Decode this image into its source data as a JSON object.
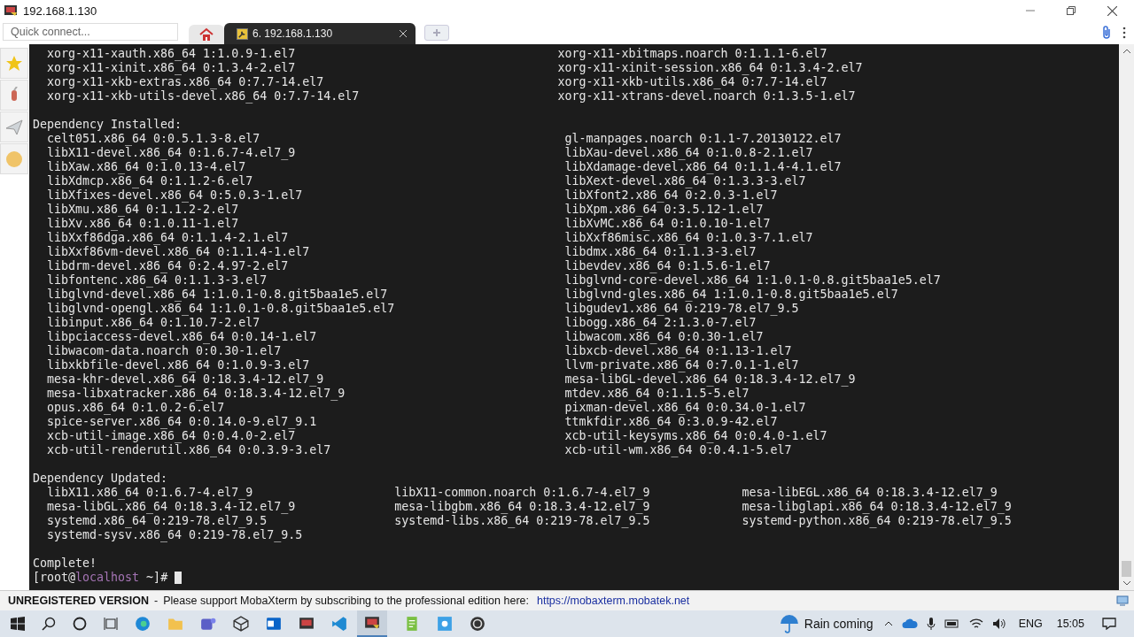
{
  "window": {
    "title": "192.168.1.130"
  },
  "tab_bar": {
    "quick_connect": {
      "placeholder": "Quick connect..."
    },
    "tabs": [
      {
        "label": "6. 192.168.1.130",
        "selected": true
      }
    ]
  },
  "terminal": {
    "blocks": [
      {
        "rows": [
          [
            "xorg-x11-xauth.x86_64 1:1.0.9-1.el7",
            "xorg-x11-xbitmaps.noarch 0:1.1.1-6.el7"
          ],
          [
            "xorg-x11-xinit.x86_64 0:1.3.4-2.el7",
            "xorg-x11-xinit-session.x86_64 0:1.3.4-2.el7"
          ],
          [
            "xorg-x11-xkb-extras.x86_64 0:7.7-14.el7",
            "xorg-x11-xkb-utils.x86_64 0:7.7-14.el7"
          ],
          [
            "xorg-x11-xkb-utils-devel.x86_64 0:7.7-14.el7",
            "xorg-x11-xtrans-devel.noarch 0:1.3.5-1.el7"
          ]
        ]
      },
      {
        "heading": "Dependency Installed:",
        "rows": [
          [
            "celt051.x86_64 0:0.5.1.3-8.el7",
            "gl-manpages.noarch 0:1.1-7.20130122.el7"
          ],
          [
            "libX11-devel.x86_64 0:1.6.7-4.el7_9",
            "libXau-devel.x86_64 0:1.0.8-2.1.el7"
          ],
          [
            "libXaw.x86_64 0:1.0.13-4.el7",
            "libXdamage-devel.x86_64 0:1.1.4-4.1.el7"
          ],
          [
            "libXdmcp.x86_64 0:1.1.2-6.el7",
            "libXext-devel.x86_64 0:1.3.3-3.el7"
          ],
          [
            "libXfixes-devel.x86_64 0:5.0.3-1.el7",
            "libXfont2.x86_64 0:2.0.3-1.el7"
          ],
          [
            "libXmu.x86_64 0:1.1.2-2.el7",
            "libXpm.x86_64 0:3.5.12-1.el7"
          ],
          [
            "libXv.x86_64 0:1.0.11-1.el7",
            "libXvMC.x86_64 0:1.0.10-1.el7"
          ],
          [
            "libXxf86dga.x86_64 0:1.1.4-2.1.el7",
            "libXxf86misc.x86_64 0:1.0.3-7.1.el7"
          ],
          [
            "libXxf86vm-devel.x86_64 0:1.1.4-1.el7",
            "libdmx.x86_64 0:1.1.3-3.el7"
          ],
          [
            "libdrm-devel.x86_64 0:2.4.97-2.el7",
            "libevdev.x86_64 0:1.5.6-1.el7"
          ],
          [
            "libfontenc.x86_64 0:1.1.3-3.el7",
            "libglvnd-core-devel.x86_64 1:1.0.1-0.8.git5baa1e5.el7"
          ],
          [
            "libglvnd-devel.x86_64 1:1.0.1-0.8.git5baa1e5.el7",
            "libglvnd-gles.x86_64 1:1.0.1-0.8.git5baa1e5.el7"
          ],
          [
            "libglvnd-opengl.x86_64 1:1.0.1-0.8.git5baa1e5.el7",
            "libgudev1.x86_64 0:219-78.el7_9.5"
          ],
          [
            "libinput.x86_64 0:1.10.7-2.el7",
            "libogg.x86_64 2:1.3.0-7.el7"
          ],
          [
            "libpciaccess-devel.x86_64 0:0.14-1.el7",
            "libwacom.x86_64 0:0.30-1.el7"
          ],
          [
            "libwacom-data.noarch 0:0.30-1.el7",
            "libxcb-devel.x86_64 0:1.13-1.el7"
          ],
          [
            "libxkbfile-devel.x86_64 0:1.0.9-3.el7",
            "llvm-private.x86_64 0:7.0.1-1.el7"
          ],
          [
            "mesa-khr-devel.x86_64 0:18.3.4-12.el7_9",
            "mesa-libGL-devel.x86_64 0:18.3.4-12.el7_9"
          ],
          [
            "mesa-libxatracker.x86_64 0:18.3.4-12.el7_9",
            "mtdev.x86_64 0:1.1.5-5.el7"
          ],
          [
            "opus.x86_64 0:1.0.2-6.el7",
            "pixman-devel.x86_64 0:0.34.0-1.el7"
          ],
          [
            "spice-server.x86_64 0:0.14.0-9.el7_9.1",
            "ttmkfdir.x86_64 0:3.0.9-42.el7"
          ],
          [
            "xcb-util-image.x86_64 0:0.4.0-2.el7",
            "xcb-util-keysyms.x86_64 0:0.4.0-1.el7"
          ],
          [
            "xcb-util-renderutil.x86_64 0:0.3.9-3.el7",
            "xcb-util-wm.x86_64 0:0.4.1-5.el7"
          ]
        ]
      },
      {
        "heading": "Dependency Updated:",
        "rows": [
          [
            "libX11.x86_64 0:1.6.7-4.el7_9",
            "libX11-common.noarch 0:1.6.7-4.el7_9",
            "mesa-libEGL.x86_64 0:18.3.4-12.el7_9"
          ],
          [
            "mesa-libGL.x86_64 0:18.3.4-12.el7_9",
            "mesa-libgbm.x86_64 0:18.3.4-12.el7_9",
            "mesa-libglapi.x86_64 0:18.3.4-12.el7_9"
          ],
          [
            "systemd.x86_64 0:219-78.el7_9.5",
            "systemd-libs.x86_64 0:219-78.el7_9.5",
            "systemd-python.x86_64 0:219-78.el7_9.5"
          ],
          [
            "systemd-sysv.x86_64 0:219-78.el7_9.5"
          ]
        ]
      }
    ],
    "complete": "Complete!",
    "prompt": {
      "before": "[root@",
      "host": "localhost",
      "after": " ~]#"
    }
  },
  "status_bar": {
    "label": "UNREGISTERED VERSION",
    "separator": "-",
    "message": "Please support MobaXterm by subscribing to the professional edition here:",
    "link": "https://mobaxterm.mobatek.net"
  },
  "taskbar": {
    "weather": "Rain coming",
    "language": "ENG",
    "time": "15:05"
  }
}
